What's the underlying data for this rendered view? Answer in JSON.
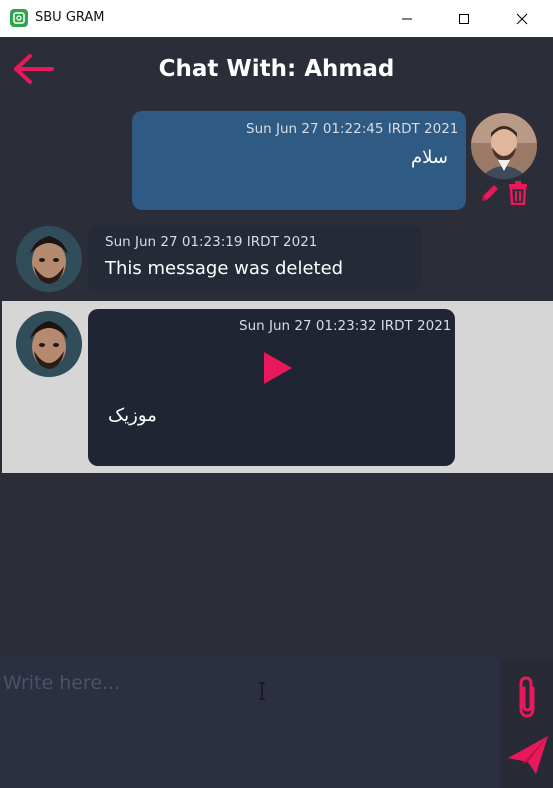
{
  "window": {
    "app_title": "SBU GRAM",
    "icons": {
      "app": "app-logo-icon",
      "minimize": "minimize-icon",
      "maximize": "maximize-icon",
      "close": "close-icon"
    }
  },
  "header": {
    "title": "Chat With: Ahmad",
    "back_icon": "arrow-left-icon"
  },
  "messages": [
    {
      "timestamp": "Sun Jun 27 01:22:45 IRDT 2021",
      "text": "سلام",
      "sender": "self",
      "actions": [
        "edit-icon",
        "delete-icon"
      ]
    },
    {
      "timestamp": "Sun Jun 27 01:23:19 IRDT 2021",
      "text": "This message was deleted",
      "sender": "other"
    },
    {
      "timestamp": "Sun Jun 27 01:23:32 IRDT 2021",
      "text": "موزیک",
      "sender": "other",
      "media": "play-icon"
    }
  ],
  "composer": {
    "placeholder": "Write here...",
    "attach_icon": "paperclip-icon",
    "send_icon": "send-icon"
  },
  "colors": {
    "accent": "#e8185a",
    "background": "#2b2d38",
    "own_bubble": "#2e5a84",
    "other_bubble": "#242a36",
    "highlight": "#d6d6d6"
  }
}
